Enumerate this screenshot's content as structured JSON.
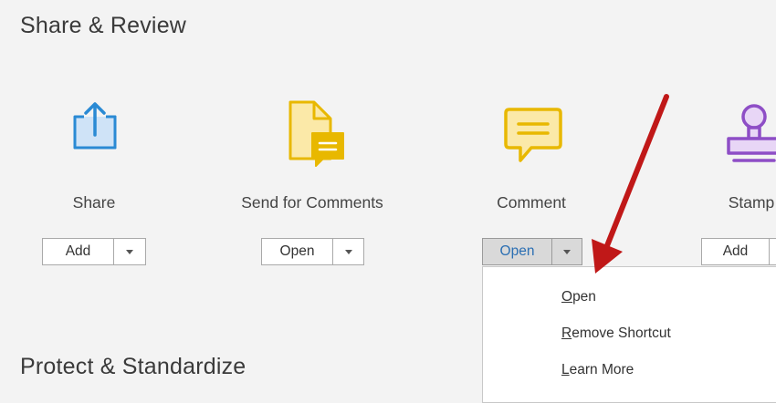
{
  "sections": {
    "share_review_title": "Share & Review",
    "protect_title": "Protect & Standardize"
  },
  "tools": [
    {
      "label": "Share",
      "button": "Add",
      "icon": "share-icon",
      "color": "#2a8ad4"
    },
    {
      "label": "Send for Comments",
      "button": "Open",
      "icon": "send-for-comments-icon",
      "color": "#e8b800"
    },
    {
      "label": "Comment",
      "button": "Open",
      "icon": "comment-icon",
      "color": "#e8b800"
    },
    {
      "label": "Stamp",
      "button": "Add",
      "icon": "stamp-icon",
      "color": "#8e4ec6"
    }
  ],
  "dropdown_menu": {
    "items": [
      {
        "accel": "O",
        "rest": "pen"
      },
      {
        "accel": "R",
        "rest": "emove Shortcut"
      },
      {
        "accel": "L",
        "rest": "earn More"
      }
    ]
  },
  "annotation": {
    "arrow_color": "#c01818"
  }
}
